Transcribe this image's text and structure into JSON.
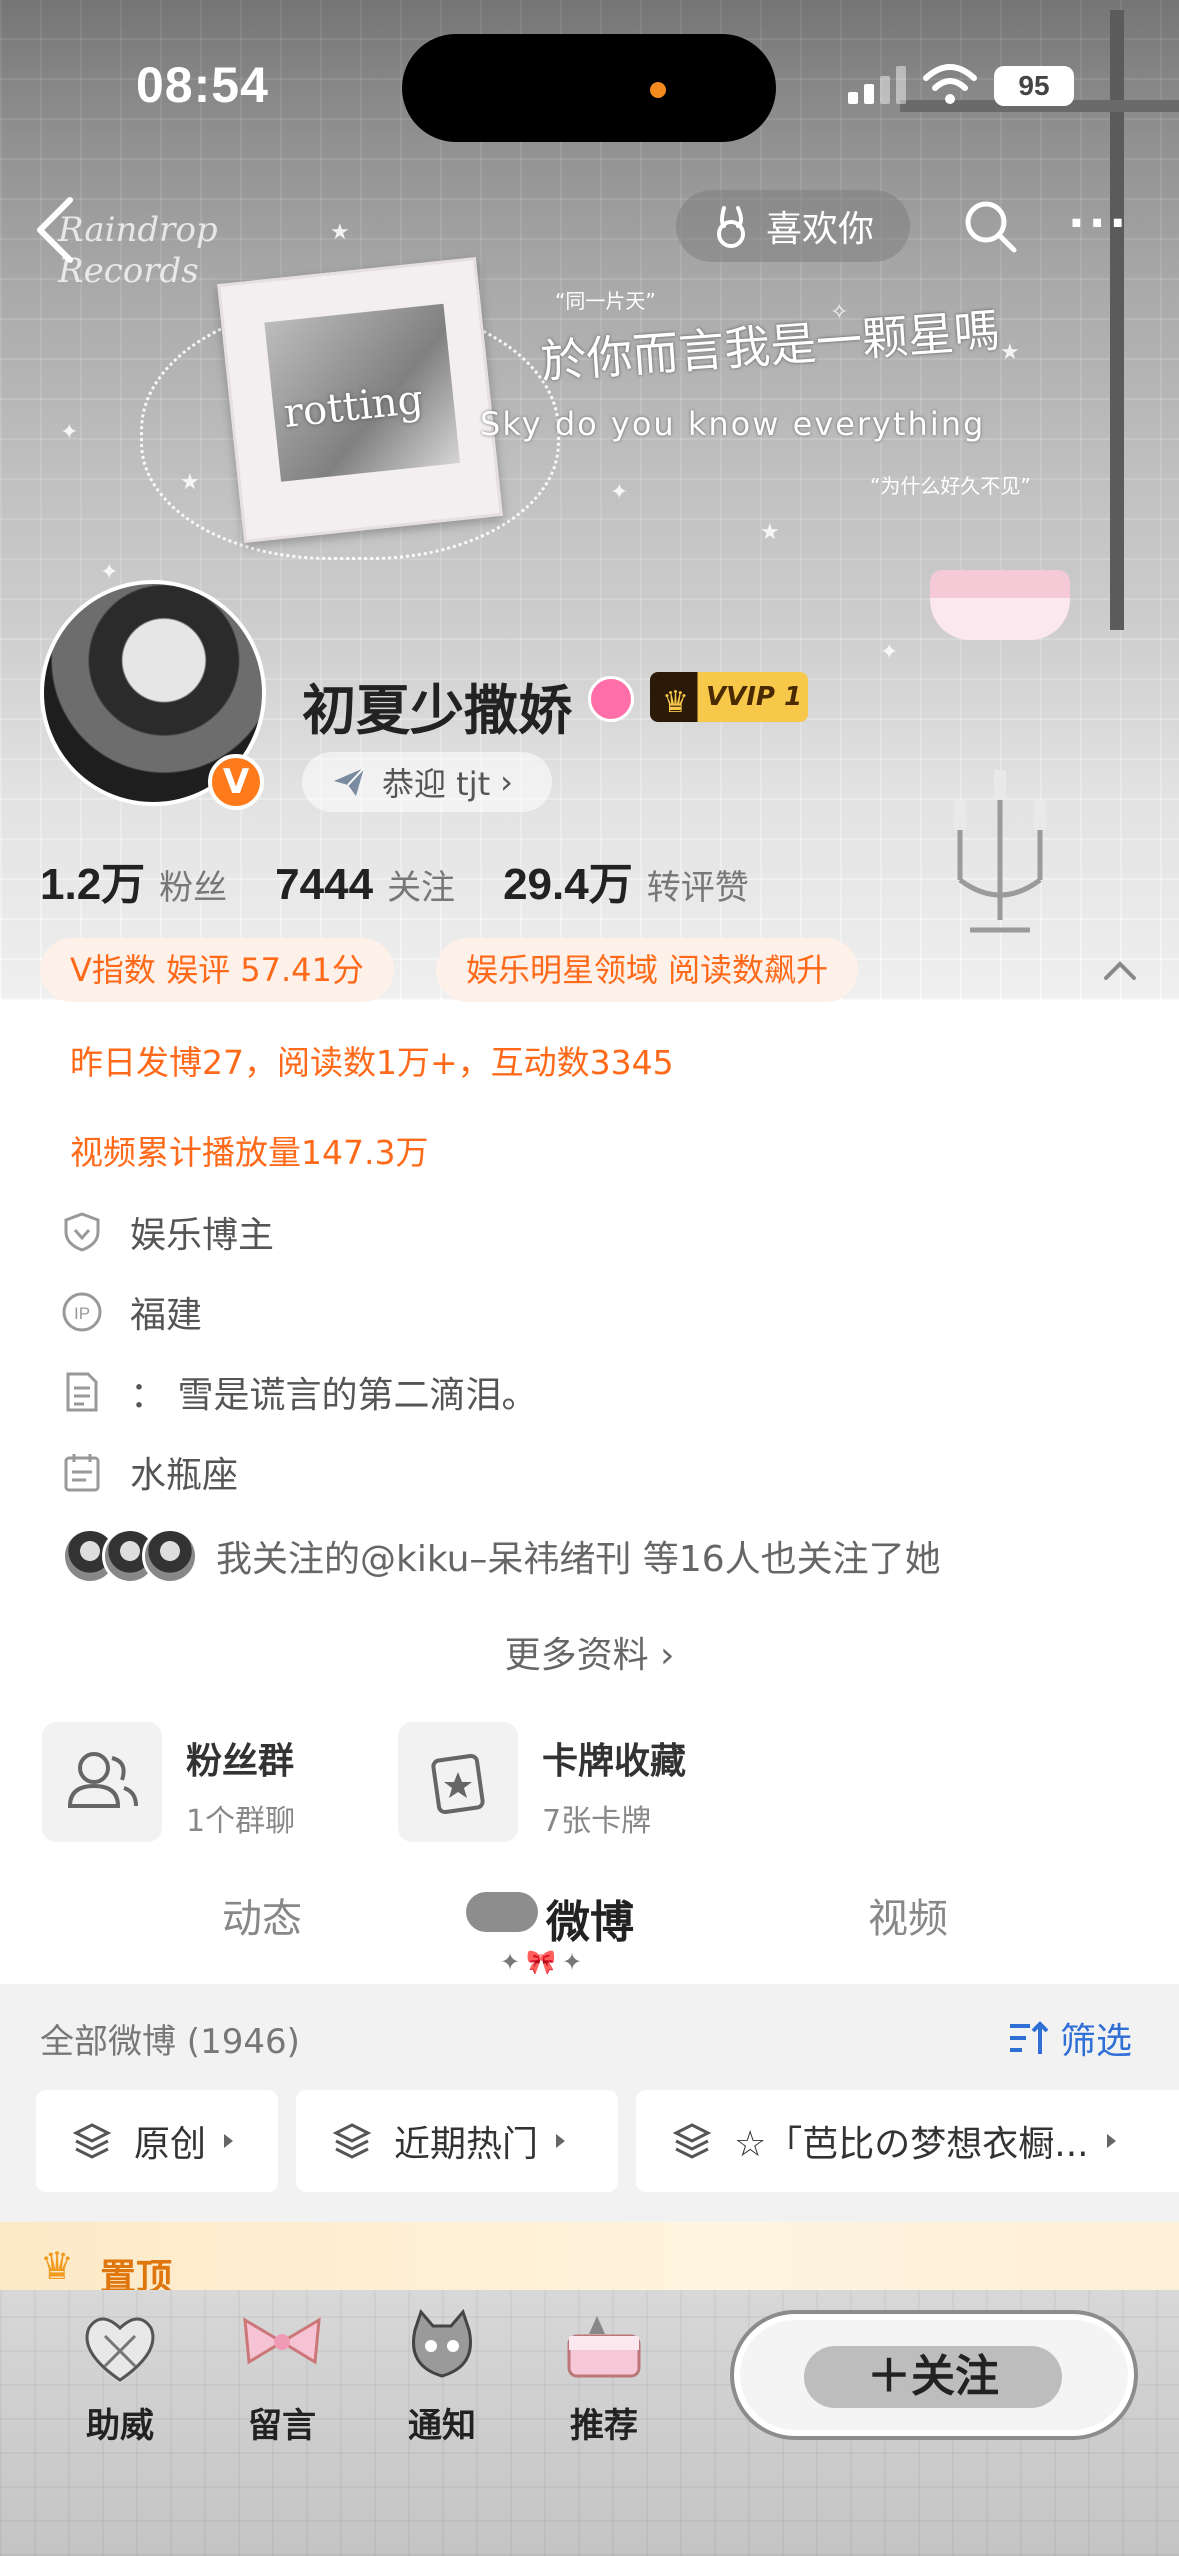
{
  "status": {
    "time": "08:54",
    "battery": "95"
  },
  "header": {
    "like_label": "喜欢你",
    "bg_text": {
      "watermark": [
        "Raindrop",
        "Records"
      ],
      "photo_word": "rotting",
      "lyric_cn": "於你而言我是一颗星嗎",
      "lyric_en": "Sky do you know everything",
      "quote1": "“同一片天”",
      "quote2": "“为什么好久不见”"
    }
  },
  "profile": {
    "username": "初夏少撒娇",
    "vvip_label": "VVIP",
    "vvip_level": "1",
    "verified_badge": "V",
    "welcome": "恭迎 tjt",
    "stats": [
      {
        "num": "1.2万",
        "label": "粉丝"
      },
      {
        "num": "7444",
        "label": "关注"
      },
      {
        "num": "29.4万",
        "label": "转评赞"
      }
    ],
    "tags": [
      "V指数 娱评 57.41分",
      "娱乐明星领域 阅读数飙升"
    ],
    "highlights": [
      "昨日发博27，阅读数1万+，互动数3345",
      "视频累计播放量147.3万"
    ],
    "info": [
      {
        "icon": "shield-icon",
        "text": "娱乐博主"
      },
      {
        "icon": "ip-icon",
        "text": "福建"
      },
      {
        "icon": "document-icon",
        "text": "： 雪是谎言的第二滴泪。"
      },
      {
        "icon": "calendar-icon",
        "text": "水瓶座"
      }
    ],
    "mutual_follow": "我关注的@kiku–呆祎绪刊  等16人也关注了她",
    "more_info": "更多资料 ›"
  },
  "cards": [
    {
      "title": "粉丝群",
      "sub": "1个群聊",
      "icon": "group-icon"
    },
    {
      "title": "卡牌收藏",
      "sub": "7张卡牌",
      "icon": "card-icon"
    }
  ],
  "tabs": [
    {
      "label": "动态",
      "active": false
    },
    {
      "label": "微博",
      "active": true
    },
    {
      "label": "视频",
      "active": false
    }
  ],
  "feed": {
    "all_label": "全部微博 (1946)",
    "filter_label": "筛选",
    "chips": [
      "原创",
      "近期热门",
      "☆「芭比の梦想衣橱..."
    ],
    "pinned_label": "置顶"
  },
  "bottom_bar": {
    "items": [
      "助威",
      "留言",
      "通知",
      "推荐"
    ],
    "follow_label": "＋关注"
  },
  "colors": {
    "accent": "#ff6a1a",
    "link": "#2f6fd6",
    "pinned": "#e0760e"
  }
}
